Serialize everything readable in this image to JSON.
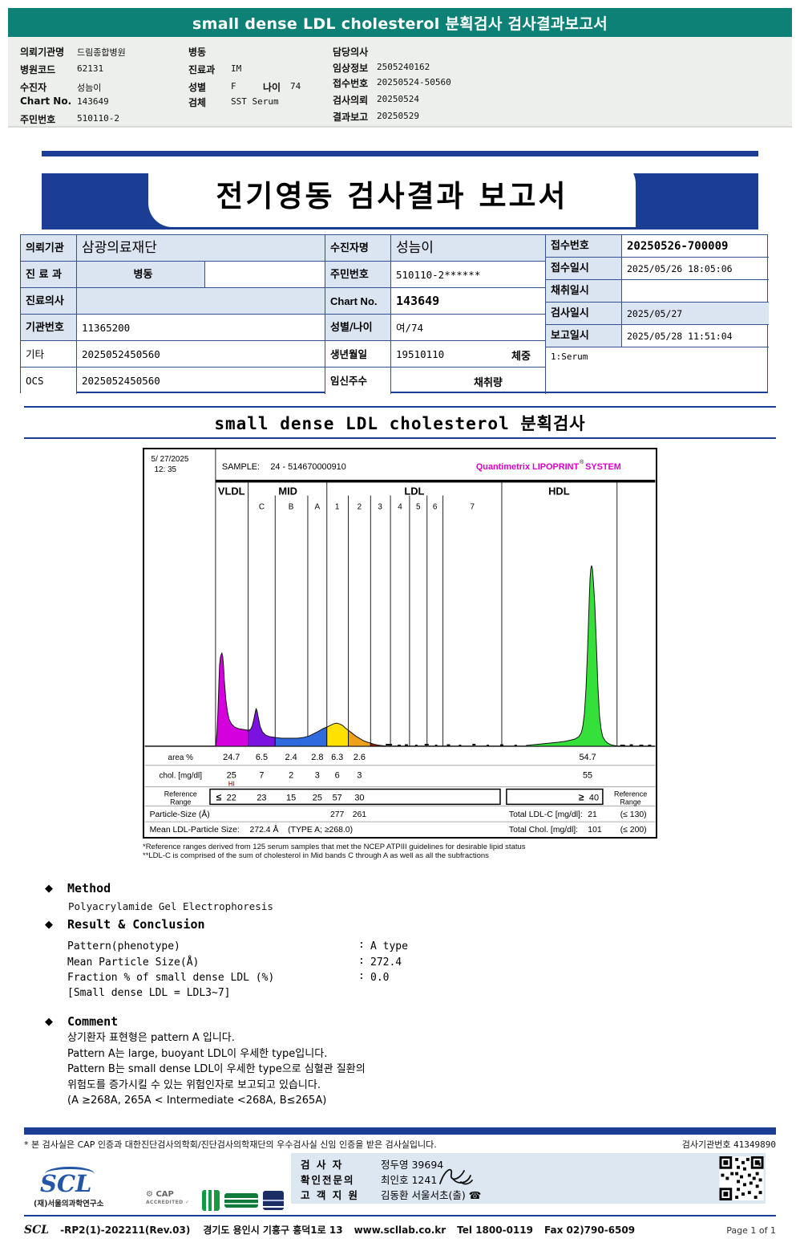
{
  "header": {
    "title": "small dense LDL cholesterol 분획검사 검사결과보고서",
    "info": {
      "c1": [
        {
          "l": "의뢰기관명",
          "v": "드림종합병원"
        },
        {
          "l": "병원코드",
          "v": "62131"
        },
        {
          "l": "수진자",
          "v": "성늠이"
        },
        {
          "l": "Chart No.",
          "v": "143649"
        },
        {
          "l": "주민번호",
          "v": "510110-2"
        }
      ],
      "c2": [
        {
          "l": "병동",
          "v": ""
        },
        {
          "l": "진료과",
          "v": "IM"
        },
        {
          "l": "성별",
          "v": "F"
        },
        {
          "l": "나이",
          "v": "74"
        },
        {
          "l": "검체",
          "v": "SST Serum"
        }
      ],
      "c3": [
        {
          "l": "담당의사",
          "v": ""
        },
        {
          "l": "임상정보",
          "v": "2505240162"
        },
        {
          "l": "접수번호",
          "v": "20250524-50560"
        },
        {
          "l": "검사의뢰",
          "v": "20250524"
        },
        {
          "l": "결과보고",
          "v": "20250529"
        }
      ]
    }
  },
  "banner": {
    "title": "전기영동 검사결과 보고서"
  },
  "ptable": {
    "l": [
      {
        "label": "의뢰기관",
        "value": "삼광의료재단"
      },
      {
        "label": "진 료 과",
        "value": "병동"
      },
      {
        "label": "진료의사",
        "value": ""
      },
      {
        "label": "기관번호",
        "value": "11365200"
      },
      {
        "label": "기타",
        "value": "2025052450560"
      },
      {
        "label": "OCS",
        "value": "2025052450560"
      }
    ],
    "m": [
      {
        "label": "수진자명",
        "value": "성늠이"
      },
      {
        "label": "주민번호",
        "value": "510110-2******"
      },
      {
        "label": "Chart No.",
        "value": "143649"
      },
      {
        "label": "성별/나이",
        "value": "여/74"
      },
      {
        "label": "생년월일",
        "value": "19510110",
        "extra": "체중"
      },
      {
        "label": "임신주수",
        "value": "",
        "extra": "채취량"
      }
    ],
    "r": [
      {
        "label": "접수번호",
        "value": "20250526-700009"
      },
      {
        "label": "접수일시",
        "value": "2025/05/26 18:05:06"
      },
      {
        "label": "채취일시",
        "value": ""
      },
      {
        "label": "검사일시",
        "value": "2025/05/27"
      },
      {
        "label": "보고일시",
        "value": "2025/05/28 11:51:04"
      }
    ],
    "serum": "1:Serum"
  },
  "section": {
    "title": "small dense LDL cholesterol 분획검사"
  },
  "chart": {
    "date": "5/ 27/2025",
    "time": "12: 35",
    "sample_label": "SAMPLE:",
    "sample_id": "24 - 514670000910",
    "brand": "Quantimetrix LIPOPRINT",
    "brand_reg": "®",
    "brand2": "SYSTEM",
    "regions": [
      "VLDL",
      "MID",
      "LDL",
      "HDL"
    ],
    "bands": [
      "C",
      "B",
      "A",
      "1",
      "2",
      "3",
      "4",
      "5",
      "6",
      "7"
    ],
    "area_label": "area %",
    "area": [
      "24.7",
      "6.5",
      "2.4",
      "2.8",
      "6.3",
      "2.6",
      "54.7"
    ],
    "chol_label": "chol. [mg/dl]",
    "chol": [
      "25",
      "7",
      "2",
      "3",
      "6",
      "3",
      "55"
    ],
    "hi_flag": "HI",
    "ref_label1": "Reference",
    "ref_label2": "Range",
    "ref_le": "≤",
    "ref": [
      "22",
      "23",
      "15",
      "25",
      "57",
      "30"
    ],
    "ref_ge": "≥",
    "ref_hdl": "40",
    "psize_label": "Particle-Size (Å)",
    "psize": [
      "277",
      "261"
    ],
    "mean_label": "Mean LDL-Particle Size:",
    "mean_value": "272.4 Å",
    "mean_type": "(TYPE A; ≥268.0)",
    "total_ldl_label": "Total LDL-C [mg/dl]:",
    "total_ldl": "21",
    "total_ldl_ref": "(≤ 130)",
    "total_chol_label": "Total Chol. [mg/dl]:",
    "total_chol": "101",
    "total_chol_ref": "(≤ 200)",
    "fn1": "*Reference ranges derived from 125 serum samples that met the NCEP ATPIII guidelines for desirable lipid status",
    "fn2": "**LDL-C is comprised of the sum of cholesterol in Mid bands C through A as well as all the subfractions"
  },
  "chart_data": {
    "type": "area",
    "title": "Quantimetrix LIPOPRINT SYSTEM lipoprotein subfraction profile",
    "categories": [
      "VLDL",
      "MID C",
      "MID B",
      "MID A",
      "LDL 1",
      "LDL 2",
      "LDL 3-7",
      "HDL"
    ],
    "series": [
      {
        "name": "area %",
        "values": [
          24.7,
          6.5,
          2.4,
          2.8,
          6.3,
          2.6,
          0.0,
          54.7
        ]
      },
      {
        "name": "chol. [mg/dl]",
        "values": [
          25,
          7,
          2,
          3,
          6,
          3,
          0,
          55
        ]
      }
    ],
    "reference_upper": [
      22,
      23,
      15,
      25,
      57,
      30,
      null,
      null
    ],
    "hdl_reference_lower": 40,
    "particle_size_A": {
      "LDL1": 277,
      "LDL2": 261
    },
    "mean_ldl_particle_size_A": 272.4,
    "total_ldl_c_mg_dl": 21,
    "total_chol_mg_dl": 101
  },
  "method": {
    "bullet": "◆",
    "title": "Method",
    "body": "Polyacrylamide Gel Electrophoresis"
  },
  "result": {
    "bullet": "◆",
    "title": "Result & Conclusion",
    "colon": ":",
    "rows": [
      {
        "label": "Pattern(phenotype)",
        "value": "A type"
      },
      {
        "label": "Mean Particle Size(Å)",
        "value": "272.4"
      },
      {
        "label": "Fraction % of small dense LDL (%)",
        "value": "0.0"
      }
    ],
    "note": "[Small dense LDL = LDL3~7]"
  },
  "comment": {
    "bullet": "◆",
    "title": "Comment",
    "lines": [
      "상기환자 표현형은 pattern A 입니다.",
      "Pattern A는 large, buoyant LDL이 우세한 type입니다.",
      "Pattern B는 small dense LDL이 우세한 type으로 심혈관 질환의",
      "위험도를 증가시킬 수 있는 위험인자로 보고되고 있습니다.",
      "(A ≥268A, 265A < Intermediate <268A, B≤265A)"
    ]
  },
  "cert": {
    "text": "* 본 검사실은 CAP 인증과 대한진단검사의학회/진단검사의학재단의 우수검사실 신임 인증을 받은 검사실입니다.",
    "org_label": "검사기관번호",
    "org_no": "41349890"
  },
  "footer": {
    "scl": "SCL",
    "scl_sub": "(재)서울의과학연구소",
    "cap1": "CAP",
    "cap2": "ACCREDITED",
    "staff": [
      {
        "label": "검  사  자",
        "value": "정두영 39694"
      },
      {
        "label": "확인전문의",
        "value": "최인호 1241"
      },
      {
        "label": "고 객 지 원",
        "value": "김동환 서울서초(출) ☎"
      }
    ],
    "doc_scl": "SCL",
    "doc_code": "-RP2(1)-202211(Rev.03)",
    "address": "경기도 용인시 기흥구 흥덕1로 13",
    "site": "www.scllab.co.kr",
    "tel": "Tel 1800-0119",
    "fax": "Fax 02)790-6509",
    "page": "Page 1 of 1"
  },
  "colors": {
    "teal": "#0e8176",
    "navy": "#1b3e94",
    "brand_magenta": "#e000c8",
    "band_vldl": "#d400dd",
    "band_mid_c": "#7b12e0",
    "band_mid_ba": "#2f6bdf",
    "band_ldl1": "#ffe100",
    "band_ldl2": "#efa11c",
    "band_hdl": "#35e03a",
    "label_cell_bg": "#dbe5f2",
    "hi_flag": "#c0391b"
  }
}
